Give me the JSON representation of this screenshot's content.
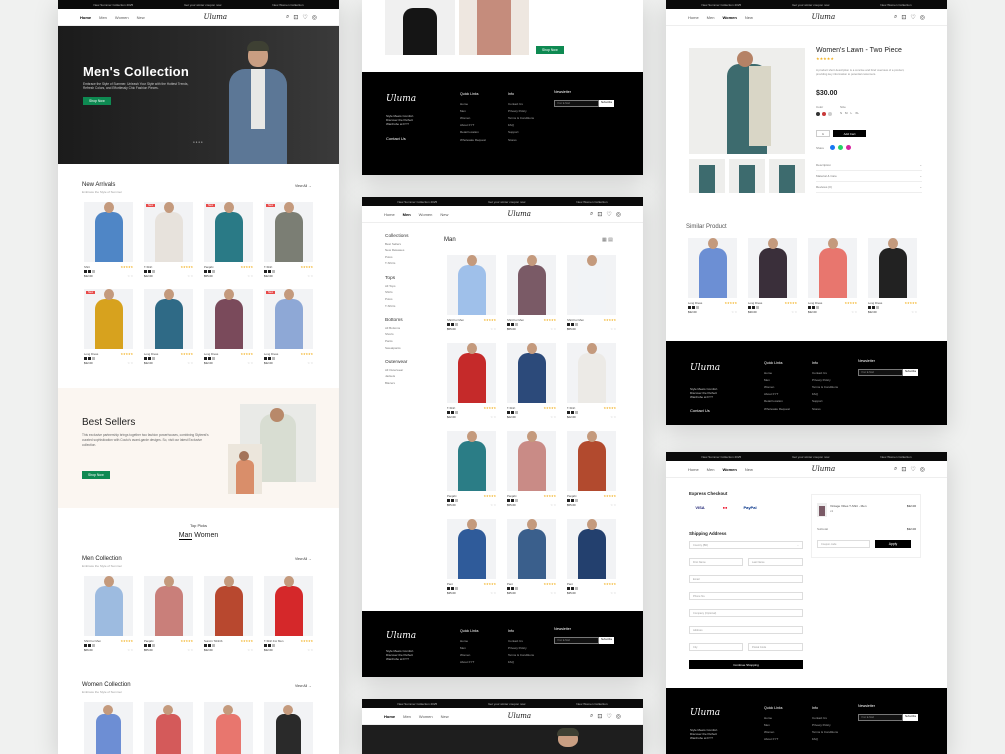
{
  "topbar": {
    "left": "New Summer Collection 2025",
    "center": "Get your winter coupon now",
    "right": "New Women Collection"
  },
  "brand": {
    "logo": "Uluma",
    "tagline": "Style Meets Comfort. Discover the Perfect Wardrobe at FYT"
  },
  "nav": {
    "home": "Home",
    "men": "Men",
    "women": "Women",
    "new": "New"
  },
  "hero": {
    "title": "Men's Collection",
    "text": "Embrace the Style of Summer. Unleash Your Style with the Hottest Trends, Refresh Colors, and Effortlessly Chic Fashion Pieces.",
    "cta": "Shop Now"
  },
  "new_arrivals": {
    "title": "New Arrivals",
    "subtitle": "Embrace the Style of Summer",
    "view_all": "View All →",
    "products": [
      {
        "name": "Shirt",
        "price": "$32.00",
        "color": "#4f86c6",
        "tag": ""
      },
      {
        "name": "T-Shirt",
        "price": "$22.00",
        "color": "#e7e2dc",
        "tag": "New"
      },
      {
        "name": "Panjabi",
        "price": "$55.00",
        "color": "#2a7a86",
        "tag": "New"
      },
      {
        "name": "T-Shirt",
        "price": "$32.00",
        "color": "#7b7e74",
        "tag": "New"
      },
      {
        "name": "Long Dress",
        "price": "$32.00",
        "color": "#d7a21e",
        "tag": "New"
      },
      {
        "name": "Long Dress",
        "price": "$32.00",
        "color": "#2f6a86",
        "tag": ""
      },
      {
        "name": "Long Dress",
        "price": "$32.00",
        "color": "#7a4a5b",
        "tag": ""
      },
      {
        "name": "Long Dress",
        "price": "$32.00",
        "color": "#8ea8d6",
        "tag": "New"
      }
    ]
  },
  "best_sellers": {
    "title": "Best Sellers",
    "text": "This exclusive partnership brings together two fashion powerhouses, combining Styleest's curated sophistication with Coutu's avant-garde designs. So, visit our latest Exclusive collection.",
    "cta": "Shop Now"
  },
  "top_picks": {
    "title": "Top Picks",
    "tab_man": "Man",
    "tab_women": "Women"
  },
  "men_collection": {
    "title": "Men Collection",
    "subtitle": "Embrace the Style of Summer",
    "view_all": "View All →",
    "products": [
      {
        "name": "Shirt For Men",
        "price": "$66.00",
        "color": "#9dbbe0"
      },
      {
        "name": "Panjabi",
        "price": "$55.00",
        "color": "#c97f7a"
      },
      {
        "name": "Suncrn Tshiirtb",
        "price": "$32.00",
        "color": "#b8482f"
      },
      {
        "name": "T-Shirt For Men",
        "price": "$32.00",
        "color": "#d5282a"
      }
    ]
  },
  "women_collection": {
    "title": "Women Collection",
    "subtitle": "Embrace the Style of Summer",
    "view_all": "View All →",
    "colors": [
      "#6d8ed4",
      "#d45a5a",
      "#e8766e",
      "#2a2a2a"
    ]
  },
  "footer": {
    "quick_links": "Quick Links",
    "quick": [
      "Home",
      "Men",
      "Women",
      "About FYT",
      "Retail location",
      "Wholesale Request"
    ],
    "info": "Info",
    "info_items": [
      "Contact Us",
      "Privacy Policy",
      "Terms & Conditions",
      "FAQ",
      "Support",
      "Stores"
    ],
    "newsletter": "Newsletter",
    "email_ph": "Your E-Mail",
    "subscribe": "Subscribe",
    "contact": "Contact Us"
  },
  "listing": {
    "title": "Man",
    "sidebar": {
      "collections": "Collections",
      "c_items": [
        "Best Sellers",
        "New Releases",
        "Polos",
        "T-Shirts"
      ],
      "tops": "Tops",
      "t_items": [
        "All Tops",
        "Shirts",
        "Polos",
        "T-Shirts"
      ],
      "bottoms": "Bottoms",
      "b_items": [
        "All Bottoms",
        "Shorts",
        "Pants",
        "Sweatpants"
      ],
      "outerwear": "Outerwear",
      "o_items": [
        "All Outerwear",
        "Jackets",
        "Blazers"
      ]
    },
    "products": [
      {
        "name": "Shirt For Men",
        "price": "$55.00",
        "color": "#9fc0ea"
      },
      {
        "name": "Shirt For Men",
        "price": "$55.00",
        "color": "#7a5a66"
      },
      {
        "name": "Shirt For Men",
        "price": "$55.00",
        "color": "#f1f3f6"
      },
      {
        "name": "T-Shirt",
        "price": "$22.00",
        "color": "#c52a2a"
      },
      {
        "name": "T-Shirt",
        "price": "$22.00",
        "color": "#2c4a7a"
      },
      {
        "name": "T-Shirt",
        "price": "$22.00",
        "color": "#eceae6"
      },
      {
        "name": "Panjabi",
        "price": "$55.00",
        "color": "#2b7d86"
      },
      {
        "name": "Panjabi",
        "price": "$55.00",
        "color": "#c98b86"
      },
      {
        "name": "Panjabi",
        "price": "$55.00",
        "color": "#b24a2e"
      },
      {
        "name": "Pant",
        "price": "$35.00",
        "color": "#2f5b9a"
      },
      {
        "name": "Pant",
        "price": "$35.00",
        "color": "#3a5f8c"
      },
      {
        "name": "Pant",
        "price": "$35.00",
        "color": "#23406e"
      }
    ]
  },
  "product": {
    "title": "Women's Lawn - Two Piece",
    "desc": "A product short description is a concise and brief overview of a product, providing key information to potential customers.",
    "price": "$30.00",
    "color_label": "Color",
    "size_label": "Size",
    "sizes": [
      "S",
      "M",
      "L",
      "XL"
    ],
    "qty": "1",
    "add_cart": "Add Cart",
    "share": "Share",
    "acc": [
      "Description",
      "Material & Care",
      "Reviews (0)"
    ]
  },
  "similar": {
    "title": "Similar Product",
    "products": [
      {
        "name": "Long Dress",
        "price": "$32.00",
        "color": "#6c8fd4"
      },
      {
        "name": "Long Dress",
        "price": "$30.00",
        "color": "#3a2f3a"
      },
      {
        "name": "Long Dress",
        "price": "$32.00",
        "color": "#e8766e"
      },
      {
        "name": "Long Dress",
        "price": "$32.00",
        "color": "#222"
      }
    ]
  },
  "checkout": {
    "express": "Express Checkout",
    "pay": [
      "VISA",
      "●●",
      "PayPal"
    ],
    "shipping": "Shipping Address",
    "country": "Country (BD)",
    "fields": [
      "First Name",
      "Last Name",
      "Email",
      "Phone No.",
      "Company (Optional)",
      "Address",
      "City",
      "Postal Code"
    ],
    "continue": "Continue Shopping",
    "item_name": "Vintage Vibes T-Shirt - Men",
    "item_price": "$32.00",
    "item_qty": "x1",
    "subtotal_label": "Subtotal",
    "subtotal": "$32.00",
    "coupon_ph": "Coupon code",
    "apply": "Apply"
  }
}
